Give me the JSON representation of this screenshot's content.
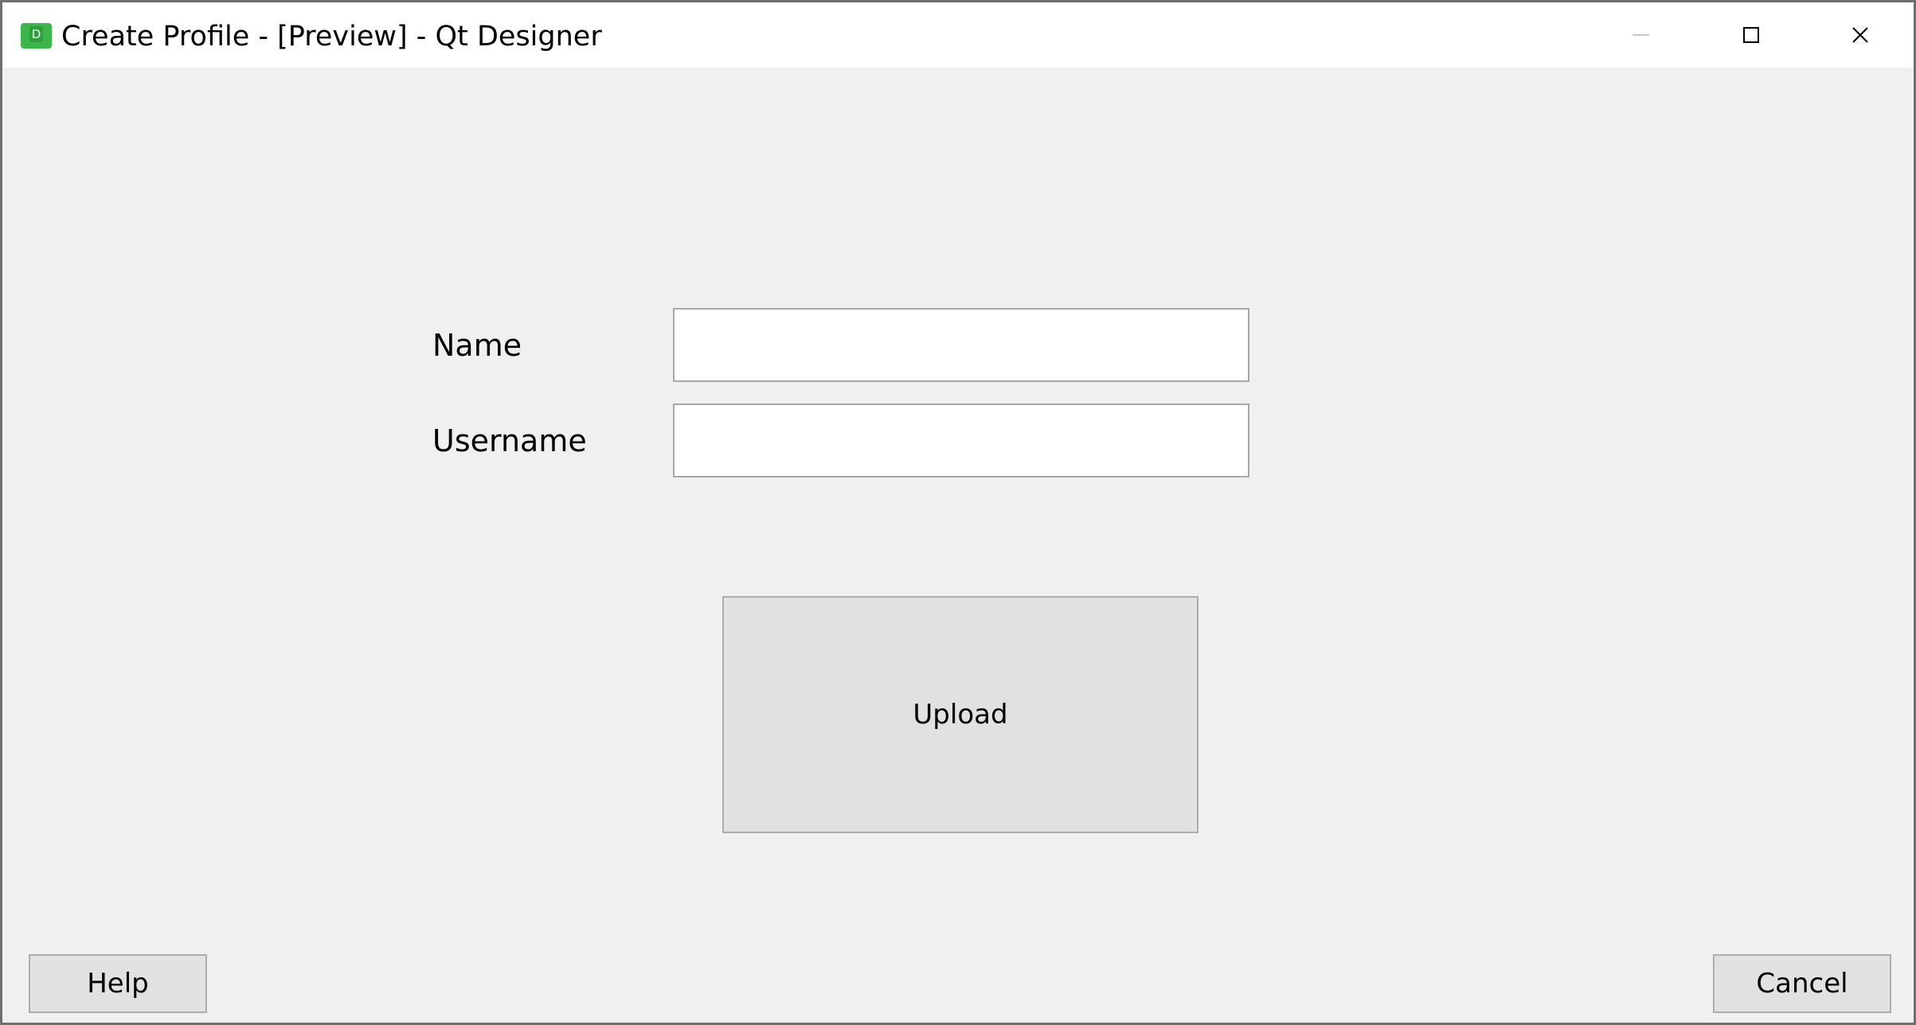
{
  "window": {
    "title": "Create Profile - [Preview] - Qt Designer",
    "app_icon_letter": "D",
    "controls": {
      "minimize": "minimize-icon",
      "maximize": "maximize-icon",
      "close": "close-icon"
    }
  },
  "form": {
    "name_label": "Name",
    "name_value": "",
    "username_label": "Username",
    "username_value": "",
    "upload_label": "Upload"
  },
  "footer": {
    "help_label": "Help",
    "cancel_label": "Cancel"
  },
  "colors": {
    "background": "#f0f0f0",
    "titlebar": "#ffffff",
    "button_face": "#e1e1e1",
    "app_icon": "#3cb54a"
  }
}
